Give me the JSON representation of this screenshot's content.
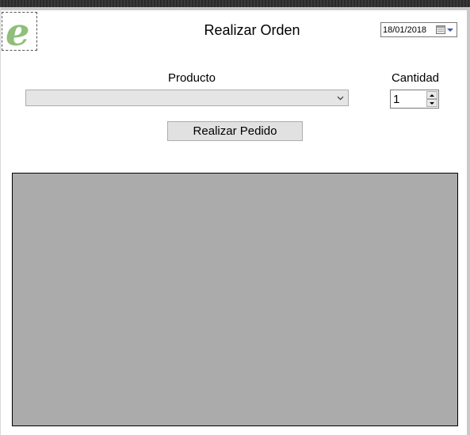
{
  "form": {
    "title": "Realizar Orden",
    "logo_letter": "e"
  },
  "date_picker": {
    "value": "18/01/2018"
  },
  "producto": {
    "label": "Producto",
    "selected": ""
  },
  "cantidad": {
    "label": "Cantidad",
    "value": "1"
  },
  "actions": {
    "submit_label": "Realizar Pedido"
  },
  "colors": {
    "grid_background": "#ababab",
    "logo_green": "#8fbf7a"
  }
}
